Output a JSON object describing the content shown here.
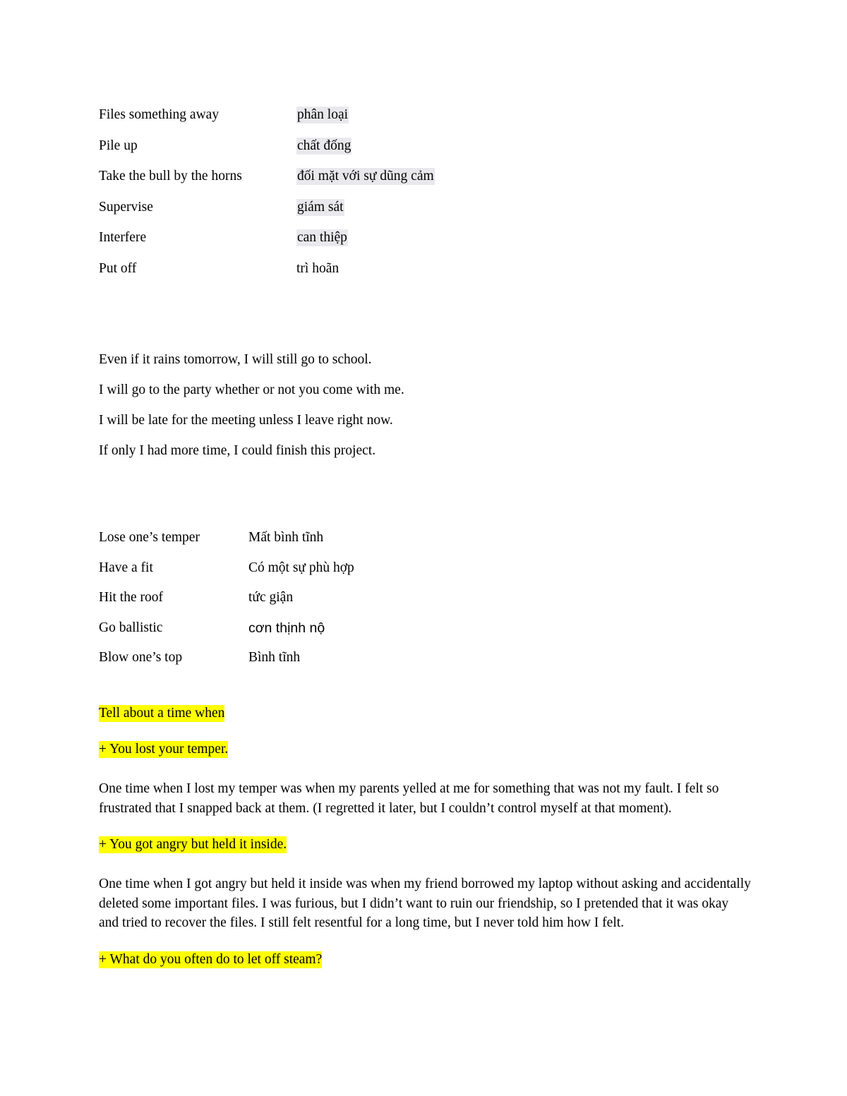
{
  "document": {
    "vocab_table_1": {
      "rows": [
        {
          "english": "Files something away",
          "vietnamese": "phân loại",
          "highlighted": true
        },
        {
          "english": "Pile up",
          "vietnamese": "chất đống",
          "highlighted": true
        },
        {
          "english": "Take the bull by the horns",
          "vietnamese": "đối mặt với sự dũng cảm",
          "highlighted": true
        },
        {
          "english": "Supervise",
          "vietnamese": "giám sát",
          "highlighted": true
        },
        {
          "english": "Interfere",
          "vietnamese": "can thiệp",
          "highlighted": true
        },
        {
          "english": "Put off",
          "vietnamese": "trì hoãn",
          "highlighted": false
        }
      ]
    },
    "example_sentences": [
      "Even if it rains tomorrow, I will still go to school.",
      "I will go to the party whether or not you come with me.",
      "I will be late for the meeting unless I leave right now.",
      "If only I had more time, I could finish this project."
    ],
    "vocab_table_2": {
      "rows": [
        {
          "english": "Lose one’s temper",
          "vietnamese": "Mất bình tĩnh"
        },
        {
          "english": "Have a fit",
          "vietnamese": "Có một sự phù hợp"
        },
        {
          "english": "Hit the roof",
          "vietnamese": "tức giận"
        },
        {
          "english": "Go ballistic",
          "vietnamese": "cơn thịnh nộ"
        },
        {
          "english": "Blow one’s top",
          "vietnamese": "Bình tĩnh"
        }
      ]
    },
    "speaking_section": {
      "heading": "Tell about a time when",
      "prompt_1": "+ You lost your temper.",
      "answer_1": "One time when I lost my temper was when my parents yelled at me for something that was not my fault. I felt so frustrated that I snapped back at them. (I regretted it later, but I couldn’t control myself at that moment).",
      "prompt_2": "+ You got angry but held it inside.",
      "answer_2": "One time when I got angry but held it inside was when my friend borrowed my laptop without asking and accidentally deleted some important files. I was furious, but I didn’t want to ruin our friendship, so I pretended that it was okay and tried to recover the files. I still felt resentful for a long time, but I never told him how I felt.",
      "prompt_3": "+ What do you often do to let off steam?"
    },
    "colors": {
      "highlight_yellow": "#ffff00",
      "highlight_gray": "#e9e9ed",
      "text": "#000000",
      "page_background": "#ffffff"
    }
  }
}
